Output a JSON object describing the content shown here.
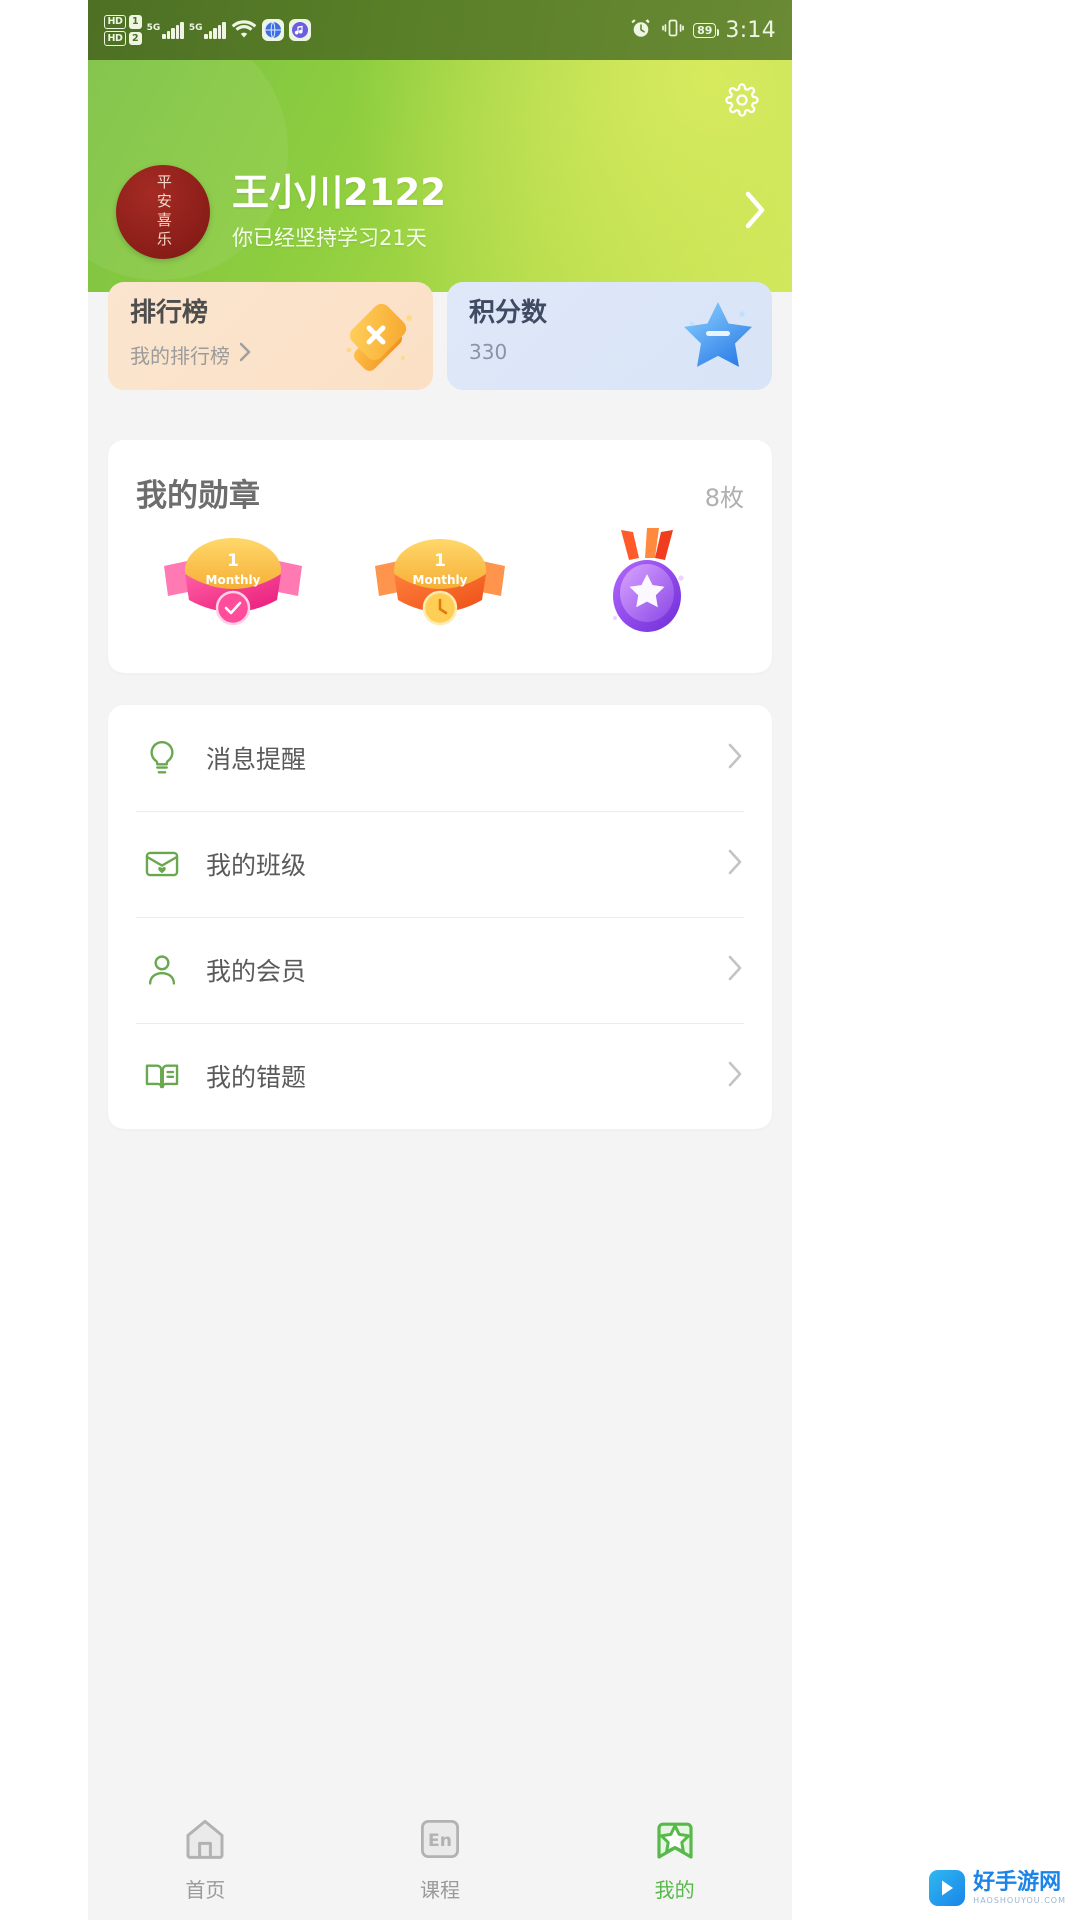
{
  "status_bar": {
    "hd1_label": "HD",
    "hd1_sim": "1",
    "hd2_label": "HD",
    "hd2_sim": "2",
    "network_1": "5G",
    "network_2": "5G",
    "battery_level": "89",
    "time": "3:14",
    "icons": [
      "hd-sim-icon",
      "signal-icon",
      "wifi-icon",
      "browser-icon",
      "music-icon",
      "alarm-icon",
      "vibrate-icon",
      "battery-icon"
    ],
    "background_color": "#597f28"
  },
  "header": {
    "settings_icon": "gear-icon",
    "avatar_text": "平安喜乐",
    "user_name": "王小川2122",
    "streak_text": "你已经坚持学习21天",
    "chevron_icon": "chevron-right-icon",
    "gradient_from": "#7cc142",
    "gradient_to": "#cfe65a"
  },
  "stat_cards": [
    {
      "title": "排行榜",
      "subtitle": "我的排行榜",
      "art_icon": "orange-box-icon",
      "accent": "#fbe5cf",
      "has_chevron": true
    },
    {
      "title": "积分数",
      "subtitle": "330",
      "art_icon": "blue-star-icon",
      "accent": "#dfe8f8",
      "has_chevron": false
    }
  ],
  "badges": {
    "title": "我的勋章",
    "count": "8枚",
    "items": [
      {
        "name": "monthly-pink-ribbon-badge",
        "label": "Monthly",
        "rank": "1",
        "color": "#ef2f7a"
      },
      {
        "name": "monthly-orange-ribbon-badge",
        "label": "Monthly",
        "rank": "1",
        "color": "#f2662a"
      },
      {
        "name": "purple-star-medal-badge",
        "label": "",
        "rank": "",
        "color": "#8b45e0"
      }
    ]
  },
  "menu": {
    "items": [
      {
        "label": "消息提醒",
        "icon": "lightbulb-icon"
      },
      {
        "label": "我的班级",
        "icon": "envelope-heart-icon"
      },
      {
        "label": "我的会员",
        "icon": "person-icon"
      },
      {
        "label": "我的错题",
        "icon": "book-icon"
      }
    ],
    "chevron_icon": "chevron-right-icon"
  },
  "tabbar": {
    "active_color": "#57b94a",
    "inactive_color": "#9a9a9a",
    "items": [
      {
        "label": "首页",
        "icon": "home-icon",
        "active": false
      },
      {
        "label": "课程",
        "icon": "en-course-icon",
        "active": false
      },
      {
        "label": "我的",
        "icon": "bookmark-star-icon",
        "active": true
      }
    ]
  },
  "watermark": {
    "main": "好手游网",
    "sub": "HAOSHOUYOU.COM",
    "icon": "play-badge-icon"
  }
}
